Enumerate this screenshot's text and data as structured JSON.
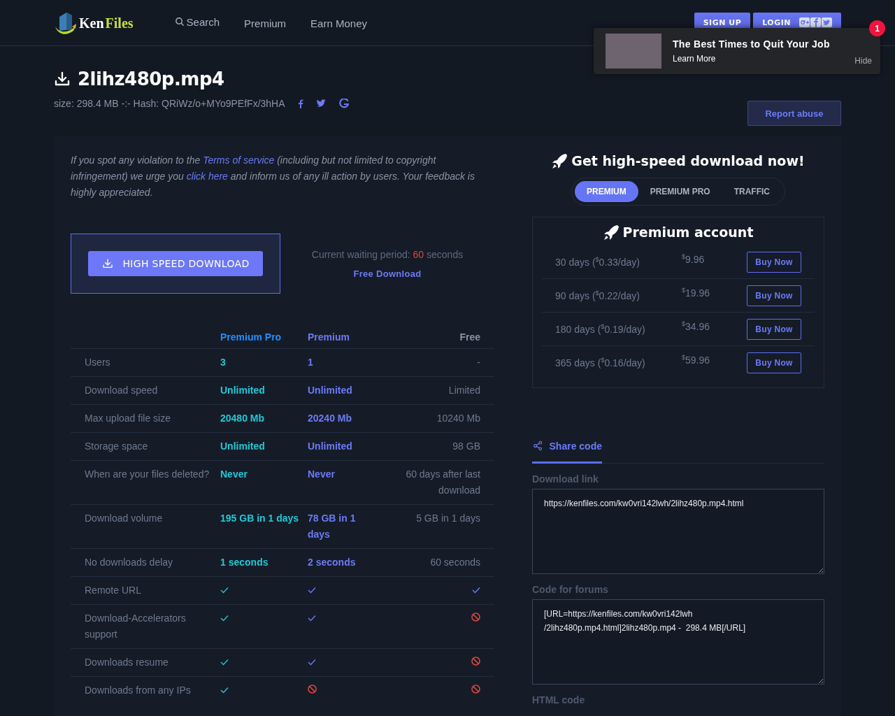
{
  "header": {
    "logo": [
      "Ken",
      "Files"
    ],
    "nav": [
      {
        "label": "Search",
        "kind": "search"
      },
      {
        "label": "Premium",
        "kind": "link"
      },
      {
        "label": "Earn Money",
        "kind": "link"
      }
    ],
    "signup": "SIGN UP",
    "login": "LOGIN"
  },
  "ad": {
    "title": "The Best Times to Quit Your Job",
    "cta": "Learn More",
    "hide": "Hide",
    "badge": "1"
  },
  "file": {
    "name": "2lihz480p.mp4",
    "meta": "size: 298.4 MB -:- Hash: QRiWz/o+MYo9PEfFx/3hHA",
    "report": "Report abuse"
  },
  "notice": [
    {
      "text": "If you spot any violation to the ",
      "link": false
    },
    {
      "text": "Terms of service",
      "link": true
    },
    {
      "text": " (including but not limited to copyright infringement) we urge you ",
      "link": false
    },
    {
      "text": "click here",
      "link": true
    },
    {
      "text": " and inform us of any ill action by users. Your feedback is highly appreciated.",
      "link": false
    }
  ],
  "download": {
    "button": "HIGH SPEED DOWNLOAD",
    "waiting": [
      {
        "text": "Current waiting period: ",
        "highlight": false
      },
      {
        "text": "60",
        "highlight": true
      },
      {
        "text": " seconds",
        "highlight": false
      }
    ],
    "free": "Free Download"
  },
  "compare": {
    "columns": [
      "Premium Pro",
      "Premium",
      "Free"
    ],
    "rows": [
      {
        "feature": "Users",
        "values": [
          {
            "kind": "text",
            "text": "3"
          },
          {
            "kind": "text",
            "text": "1"
          },
          {
            "kind": "text",
            "text": "-"
          }
        ]
      },
      {
        "feature": "Download speed",
        "values": [
          {
            "kind": "text",
            "text": "Unlimited"
          },
          {
            "kind": "text",
            "text": "Unlimited"
          },
          {
            "kind": "text",
            "text": "Limited"
          }
        ]
      },
      {
        "feature": "Max upload file size",
        "values": [
          {
            "kind": "text",
            "text": "20480 Mb"
          },
          {
            "kind": "text",
            "text": "20240 Mb"
          },
          {
            "kind": "text",
            "text": "10240 Mb"
          }
        ]
      },
      {
        "feature": "Storage space",
        "values": [
          {
            "kind": "text",
            "text": "Unlimited"
          },
          {
            "kind": "text",
            "text": "Unlimited"
          },
          {
            "kind": "text",
            "text": "98 GB"
          }
        ]
      },
      {
        "feature": "When are your files deleted?",
        "values": [
          {
            "kind": "text",
            "text": "Never"
          },
          {
            "kind": "text",
            "text": "Never"
          },
          {
            "kind": "text",
            "text": "60 days after last download"
          }
        ]
      },
      {
        "feature": "Download volume",
        "values": [
          {
            "kind": "text",
            "text": "195 GB in 1 days"
          },
          {
            "kind": "text",
            "text": "78 GB in 1 days"
          },
          {
            "kind": "text",
            "text": "5 GB in 1 days"
          }
        ]
      },
      {
        "feature": "No downloads delay",
        "values": [
          {
            "kind": "text",
            "text": "1 seconds"
          },
          {
            "kind": "text",
            "text": "2 seconds"
          },
          {
            "kind": "text",
            "text": "60 seconds"
          }
        ]
      },
      {
        "feature": "Remote URL",
        "values": [
          {
            "kind": "yes"
          },
          {
            "kind": "yes"
          },
          {
            "kind": "yes"
          }
        ]
      },
      {
        "feature": "Download-Accelerators support",
        "values": [
          {
            "kind": "yes"
          },
          {
            "kind": "yes"
          },
          {
            "kind": "no"
          }
        ]
      },
      {
        "feature": "Downloads resume",
        "values": [
          {
            "kind": "yes"
          },
          {
            "kind": "yes"
          },
          {
            "kind": "no"
          }
        ]
      },
      {
        "feature": "Downloads from any IPs",
        "values": [
          {
            "kind": "yes"
          },
          {
            "kind": "no"
          },
          {
            "kind": "no"
          }
        ]
      }
    ]
  },
  "offer": {
    "title": "Get high-speed download now!",
    "tabs": [
      {
        "label": "PREMIUM",
        "selected": true
      },
      {
        "label": "PREMIUM PRO",
        "selected": false
      },
      {
        "label": "TRAFFIC",
        "selected": false
      }
    ],
    "card_title": "Premium account",
    "plans": [
      {
        "period": "30 days (",
        "currency": "$",
        "per_day": "0.33/day)",
        "price": "9.96",
        "button": "Buy Now"
      },
      {
        "period": "90 days (",
        "currency": "$",
        "per_day": "0.22/day)",
        "price": "19.96",
        "button": "Buy Now"
      },
      {
        "period": "180 days (",
        "currency": "$",
        "per_day": "0.19/day)",
        "price": "34.96",
        "button": "Buy Now"
      },
      {
        "period": "365 days (",
        "currency": "$",
        "per_day": "0.16/day)",
        "price": "59.96",
        "button": "Buy Now"
      }
    ]
  },
  "share": {
    "tab": "Share code",
    "fields": [
      {
        "label": "Download link",
        "value": "https://kenfiles.com/kw0vri142lwh/2lihz480p.mp4.html"
      },
      {
        "label": "Code for forums",
        "value": "[URL=https://kenfiles.com/kw0vri142lwh /2lihz480p.mp4.html]2lihz480p.mp4 -  298.4 MB[/URL]"
      }
    ],
    "next_label": "HTML code"
  }
}
